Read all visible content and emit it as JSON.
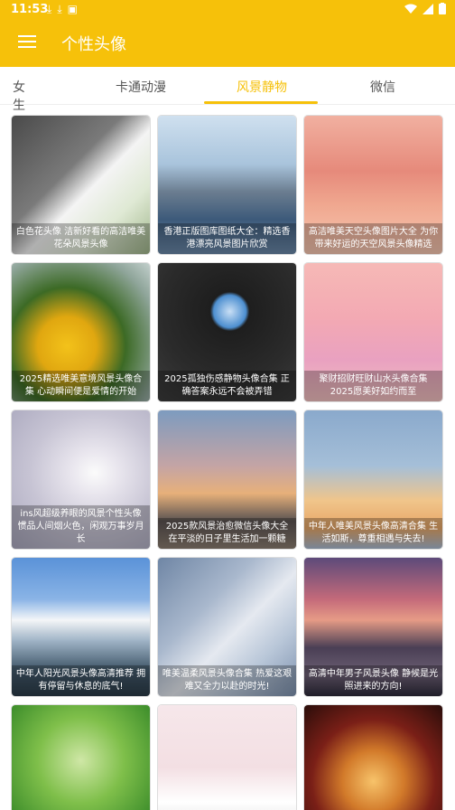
{
  "status": {
    "time": "11:53",
    "notif_icons": [
      "download-icon",
      "download-icon",
      "a-icon"
    ]
  },
  "appbar": {
    "title": "个性头像"
  },
  "tabs": [
    {
      "label": "女生",
      "active": false
    },
    {
      "label": "卡通动漫",
      "active": false
    },
    {
      "label": "风景静物",
      "active": true
    },
    {
      "label": "微信",
      "active": false
    }
  ],
  "cards": [
    {
      "caption": "白色花头像 洁新好看的高洁唯美花朵风景头像"
    },
    {
      "caption": "香港正版图库图纸大全：精选香港漂亮风景图片欣赏"
    },
    {
      "caption": "高洁唯美天空头像图片大全 为你带来好运的天空风景头像精选"
    },
    {
      "caption": "2025精选唯美意境风景头像合集 心动瞬间便是爱情的开始"
    },
    {
      "caption": "2025孤独伤感静物头像合集 正确答案永远不会被弄错"
    },
    {
      "caption": "聚财招财旺财山水头像合集 2025愿美好如约而至"
    },
    {
      "caption": "ins风超级养眼的风景个性头像 惯品人间烟火色，闲观万事岁月长"
    },
    {
      "caption": "2025款风景治愈微信头像大全 在平淡的日子里生活加一颗糖"
    },
    {
      "caption": "中年人唯美风景头像高清合集 生活如斯，尊重相遇与失去!"
    },
    {
      "caption": "中年人阳光风景头像高清推荐 拥有停留与休息的底气!"
    },
    {
      "caption": "唯美温柔风景头像合集 热爱这艰难又全力以赴的时光!"
    },
    {
      "caption": "高清中年男子风景头像 静候是光照进来的方向!"
    },
    {
      "caption": ""
    },
    {
      "caption": ""
    },
    {
      "caption": ""
    }
  ]
}
